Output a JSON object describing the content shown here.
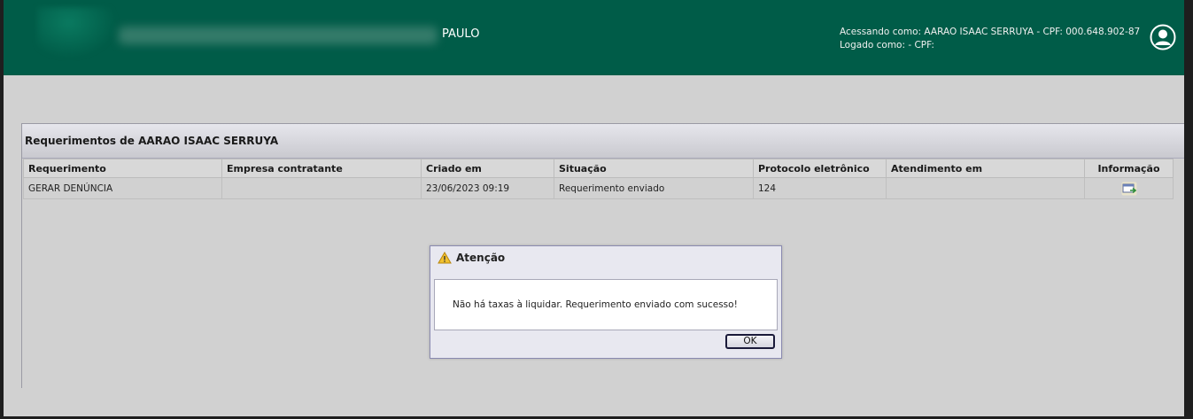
{
  "header": {
    "city": "PAULO",
    "accessing_as": "Acessando como: AARAO ISAAC SERRUYA - CPF: 000.648.902-87",
    "logged_as": "Logado como: - CPF:",
    "avatar_icon": "user-circle-icon"
  },
  "panel": {
    "title": "Requerimentos de AARAO ISAAC SERRUYA"
  },
  "table": {
    "columns": [
      "Requerimento",
      "Empresa contratante",
      "Criado em",
      "Situação",
      "Protocolo eletrônico",
      "Atendimento em",
      "Informação"
    ],
    "rows": [
      {
        "requerimento": "GERAR DENÚNCIA",
        "empresa": "",
        "criado_em": "23/06/2023 09:19",
        "situacao": "Requerimento enviado",
        "protocolo": "124",
        "atendimento": "",
        "informacao_icon": "info-window-icon"
      }
    ]
  },
  "dialog": {
    "title": "Atenção",
    "message": "Não há taxas à liquidar. Requerimento enviado com sucesso!",
    "ok_label": "OK",
    "icon": "warning-icon"
  },
  "colors": {
    "header_bg": "#005c48",
    "page_bg": "#d1d1d1"
  }
}
